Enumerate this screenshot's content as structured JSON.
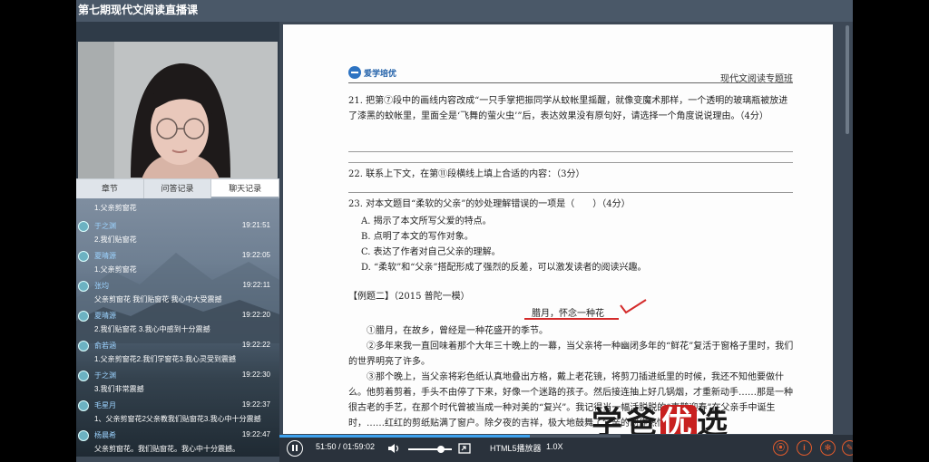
{
  "window": {
    "title": "第七期现代文阅读直播课"
  },
  "tabs": [
    {
      "label": "章节"
    },
    {
      "label": "问答记录"
    },
    {
      "label": "聊天记录"
    }
  ],
  "chat": [
    {
      "name": "",
      "time": "",
      "text": "1.父亲剪窗花"
    },
    {
      "name": "于之渊",
      "time": "19:21:51",
      "text": "2.我们贴窗花"
    },
    {
      "name": "夏晴源",
      "time": "19:22:05",
      "text": "1.父亲剪窗花"
    },
    {
      "name": "张均",
      "time": "19:22:11",
      "text": "父亲剪窗花 我们贴窗花 我心中大受震撼"
    },
    {
      "name": "夏晴源",
      "time": "19:22:20",
      "text": "2.我们贴窗花 3.我心中感到十分震撼"
    },
    {
      "name": "俞若涵",
      "time": "19:22:22",
      "text": "1.父亲剪窗花2.我们学窗花3.我心灵受到震撼"
    },
    {
      "name": "于之渊",
      "time": "19:22:30",
      "text": "3.我们非常震撼"
    },
    {
      "name": "毛星月",
      "time": "19:22:37",
      "text": "1、父亲剪窗花2父亲教我们贴窗花3.我心中十分震撼"
    },
    {
      "name": "杨晨希",
      "time": "19:22:47",
      "text": "父亲剪窗花。我们贴窗花。我心中十分震撼。"
    }
  ],
  "doc": {
    "logo_text": "爱学培优",
    "course_name": "现代文阅读专题班",
    "q21": "21. 把第⑦段中的画线内容改成“一只手掌把振同学从蚊帐里摇醒，就像变魔术那样，一个透明的玻璃瓶被放进了漆黑的蚊帐里，里面全是‘飞舞的萤火虫’”后，表达效果没有原句好，请选择一个角度说说理由。（4分）",
    "q22": "22. 联系上下文，在第⑪段横线上填上合适的内容：（3分）",
    "q23": "23. 对本文题目“柔软的父亲”的妙处理解错误的一项是（　　）（4分）",
    "options": [
      "A. 揭示了本文所写父爱的特点。",
      "B. 点明了本文的写作对象。",
      "C. 表达了作者对自己父亲的理解。",
      "D. “柔软”和“父亲”搭配形成了强烈的反差，可以激发读者的阅读兴趣。"
    ],
    "example_title": "【例题二】（2015 普陀一模）",
    "article_title": "腊月，怀念一种花",
    "paragraphs": [
      "①腊月，在故乡，曾经是一种花盛开的季节。",
      "②多年来我一直回味着那个大年三十晚上的一幕，当父亲将一种幽闭多年的“鲜花”复活于窗格子里时，我们的世界明亮了许多。",
      "③那个晚上，当父亲将彩色纸认真地叠出方格，戴上老花镜，将剪刀插进纸里的时候，我还不知他要做什么。他剪着剪着，手头不由停了下来，好像一个迷路的孩子。然后接连抽上好几锅烟，才重新动手……那是一种很古老的手艺，在那个时代曾被当成一种对美的“复兴”。我记得当一幅活脱脱的“喜鹊迎春”在父亲手中诞生时，……红红的剪纸贴满了窗户。除夕夜的吉祥，极大地鼓舞了父亲的创作热情，随"
    ],
    "watermark": {
      "left": "学爸",
      "mid": "优",
      "right": "选"
    }
  },
  "player": {
    "time_current": "51:50",
    "time_total": "01:59:02",
    "time_display": "51:50 / 01:59:02",
    "progress": 0.436,
    "volume": 0.75,
    "player_label": "HTML5播放器",
    "speed": "1.0X"
  },
  "colors": {
    "accent": "#3fa2ee",
    "danger": "#e25b2c",
    "highlight": "#d42b2b"
  }
}
